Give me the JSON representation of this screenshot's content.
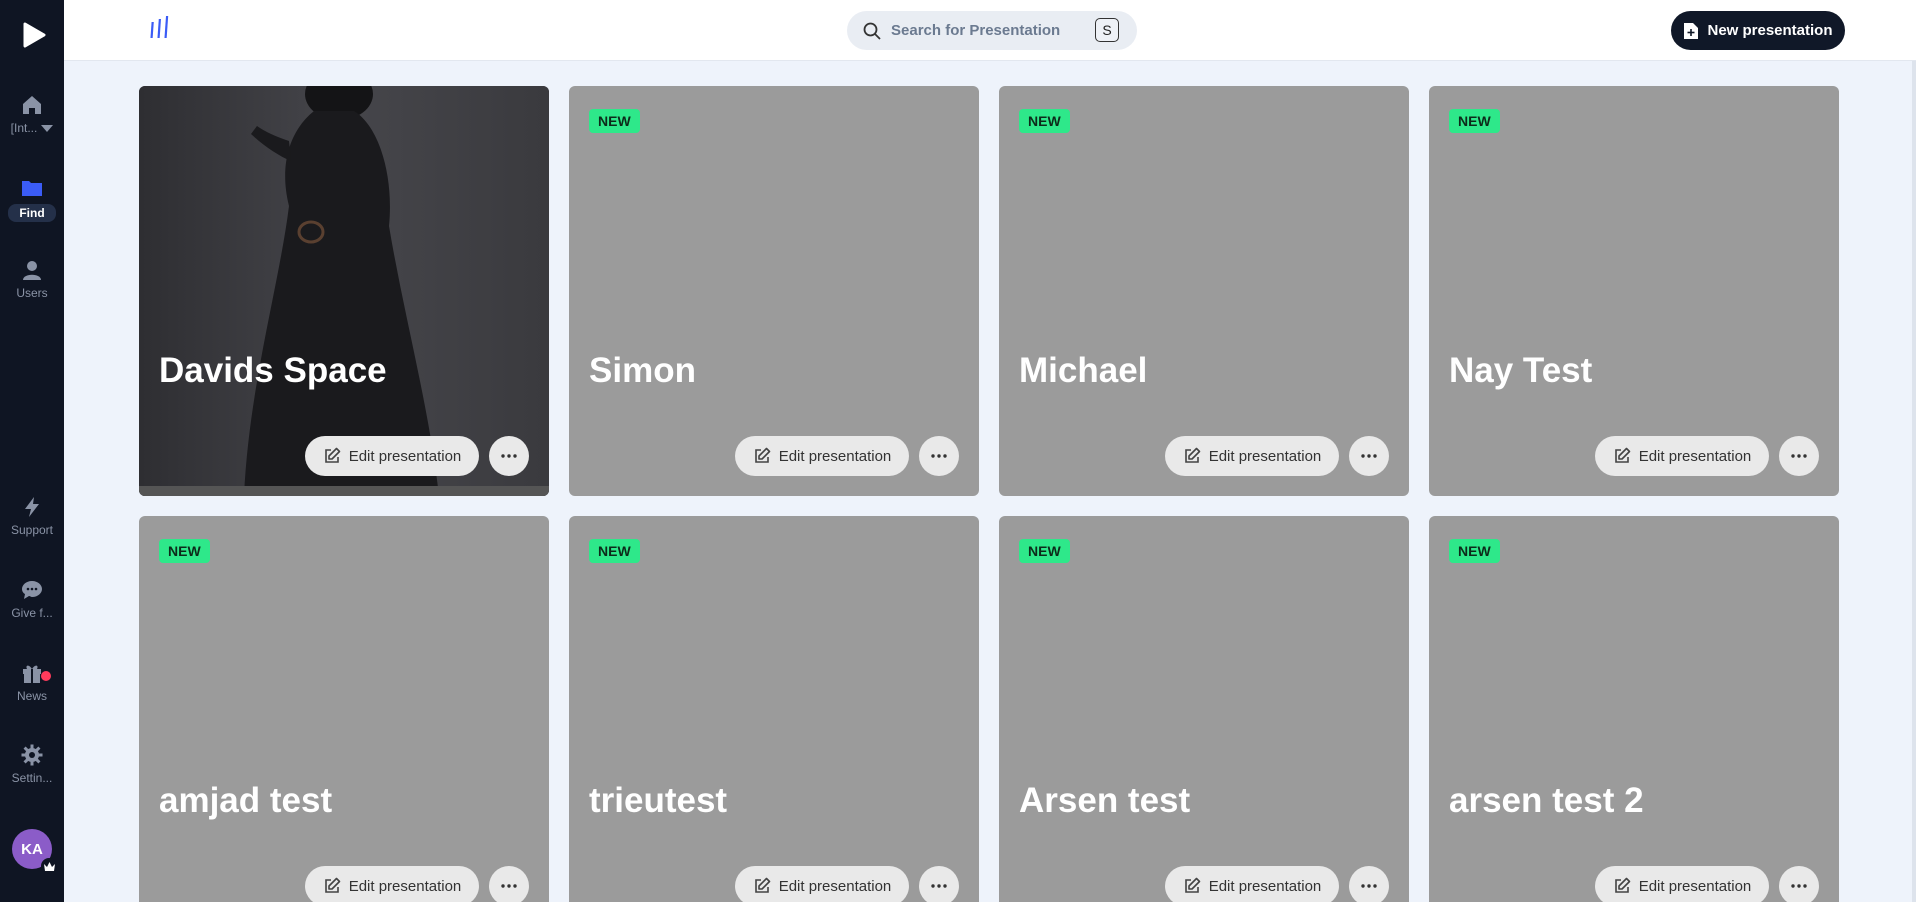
{
  "sidebar": {
    "logo_icon": "play-icon",
    "items": [
      {
        "name": "home",
        "icon": "home-icon",
        "label": "[Int..."
      },
      {
        "name": "find",
        "icon": "folder-icon",
        "label": "Find",
        "active": true
      },
      {
        "name": "users",
        "icon": "user-icon",
        "label": "Users"
      },
      {
        "name": "support",
        "icon": "bolt-icon",
        "label": "Support"
      },
      {
        "name": "feedback",
        "icon": "chat-icon",
        "label": "Give f..."
      },
      {
        "name": "news",
        "icon": "gift-icon",
        "label": "News",
        "notification": true
      },
      {
        "name": "settings",
        "icon": "gear-icon",
        "label": "Settin..."
      }
    ],
    "avatar_initials": "KA"
  },
  "topbar": {
    "search_placeholder": "Search for Presentation",
    "search_shortcut": "S",
    "new_button_label": "New presentation"
  },
  "cards": [
    {
      "title": "Davids Space",
      "badge": "",
      "edit_label": "Edit presentation",
      "has_image": true
    },
    {
      "title": "Simon",
      "badge": "NEW",
      "edit_label": "Edit presentation"
    },
    {
      "title": "Michael",
      "badge": "NEW",
      "edit_label": "Edit presentation"
    },
    {
      "title": "Nay Test",
      "badge": "NEW",
      "edit_label": "Edit presentation"
    },
    {
      "title": "amjad test",
      "badge": "NEW",
      "edit_label": "Edit presentation"
    },
    {
      "title": "trieutest",
      "badge": "NEW",
      "edit_label": "Edit presentation"
    },
    {
      "title": "Arsen test",
      "badge": "NEW",
      "edit_label": "Edit presentation"
    },
    {
      "title": "arsen test 2",
      "badge": "NEW",
      "edit_label": "Edit presentation"
    }
  ],
  "colors": {
    "sidebar_bg": "#0f1523",
    "accent_blue": "#3b5cf6",
    "badge_green": "#2ee88a",
    "card_gray": "#9b9b9b",
    "new_button_bg": "#101828"
  }
}
